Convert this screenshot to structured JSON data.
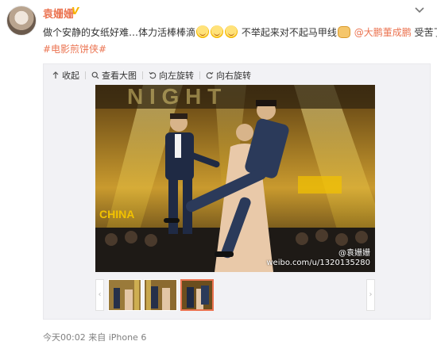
{
  "post": {
    "username": "袁姗姗",
    "verified_badge": "V",
    "text_parts": {
      "part1": "做个安静的女纸好难…体力活棒棒滴",
      "part2": "不举起来对不起马甲线",
      "mention": "@大鹏董成鹏",
      "part3": "受苦了"
    },
    "hashtag": "#电影煎饼侠#",
    "footer": "今天00:02 来自 iPhone 6"
  },
  "toolbar": {
    "collapse": "收起",
    "view_large": "查看大图",
    "rotate_left": "向左旋转",
    "rotate_right": "向右旋转"
  },
  "photo": {
    "watermark_user": "@袁姗姗",
    "watermark_url": "weibo.com/u/1320135280",
    "stage_text": "CHINA"
  },
  "thumbnails": {
    "count": 3,
    "selected_index": 3
  },
  "colors": {
    "accent": "#eb7350",
    "stage_yellow": "#f2c200"
  },
  "icons": [
    "chevron-down-icon",
    "collapse-icon",
    "search-icon",
    "rotate-left-icon",
    "rotate-right-icon",
    "verified-icon",
    "emoji-icon",
    "fist-icon"
  ]
}
